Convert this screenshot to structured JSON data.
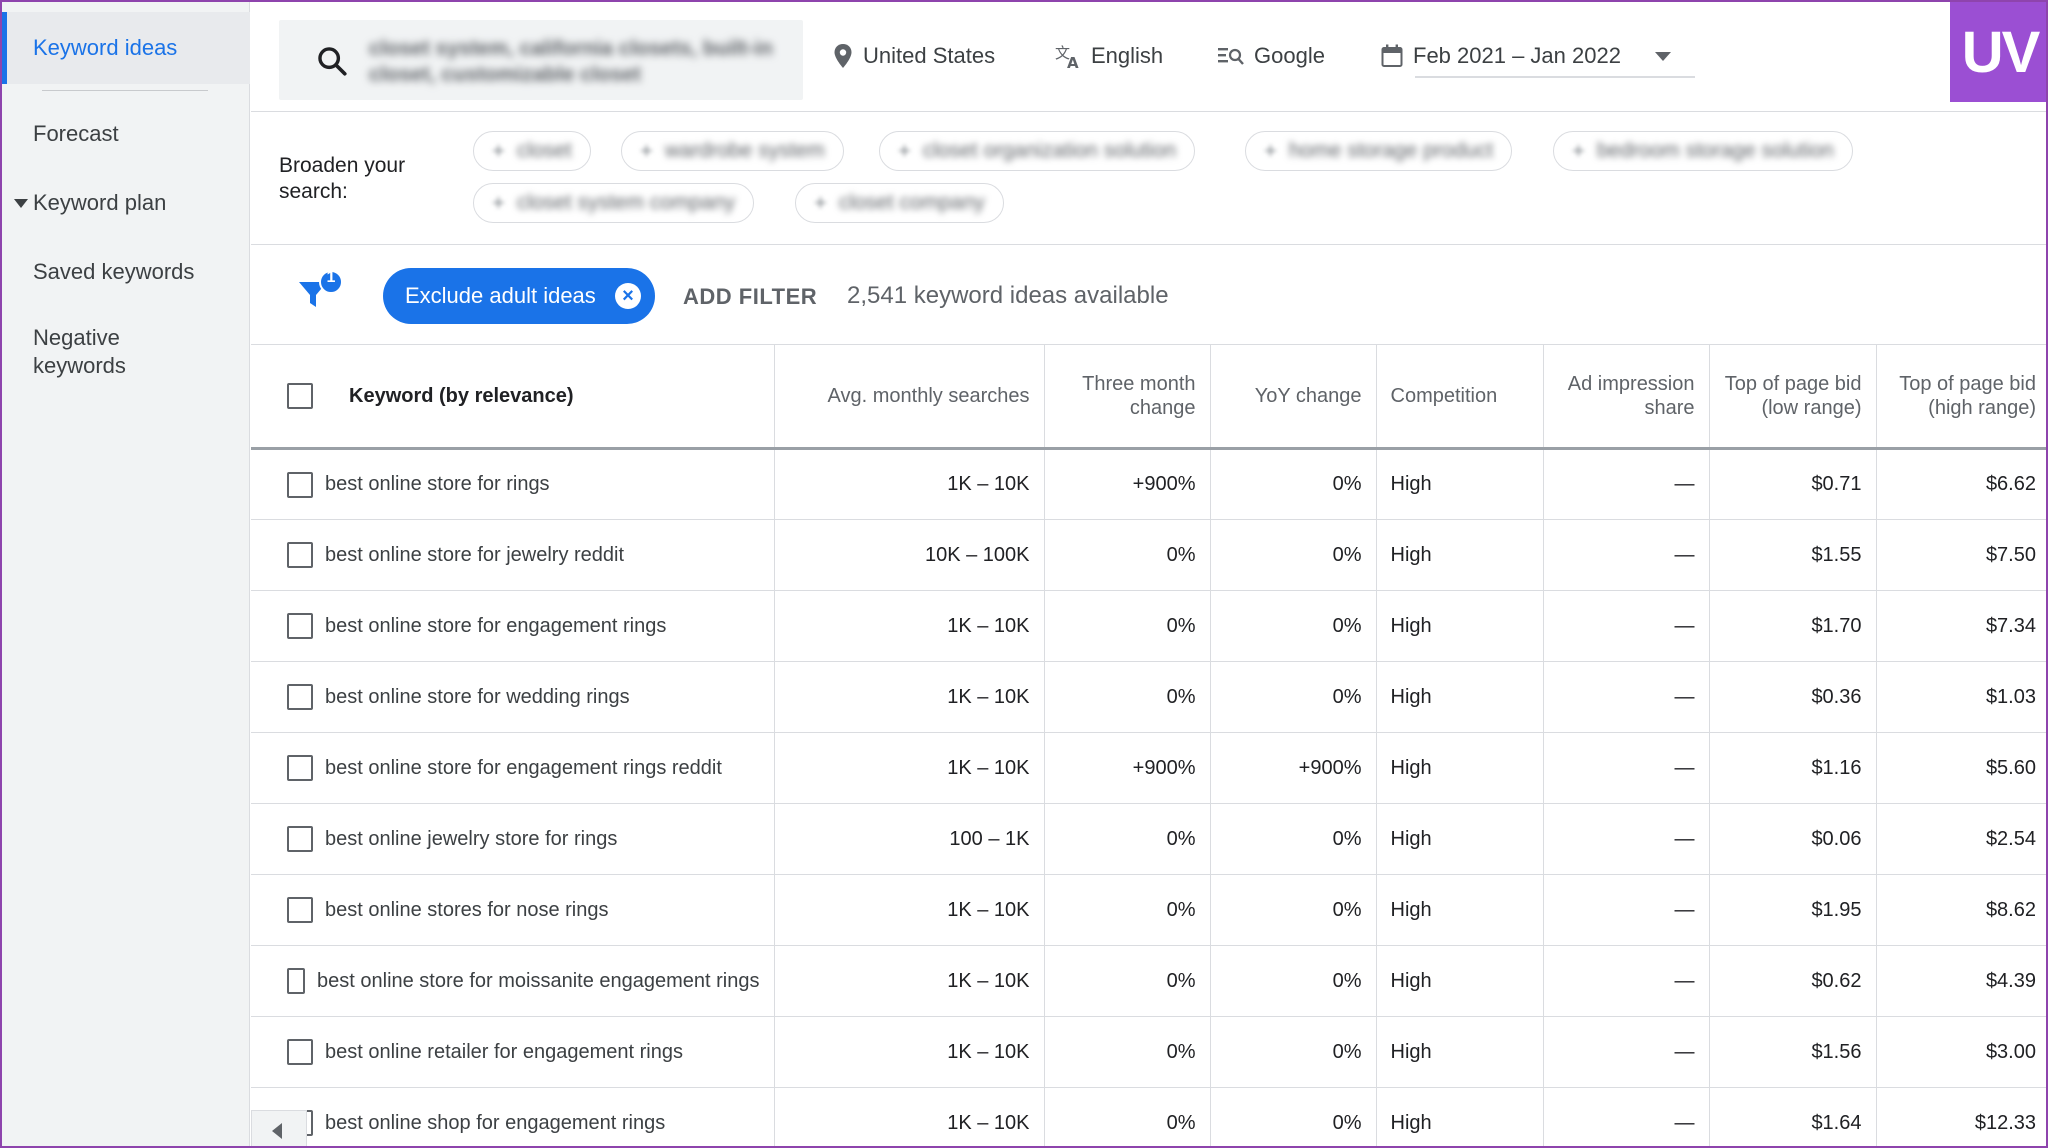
{
  "sidebar": {
    "items": [
      {
        "label": "Keyword ideas",
        "active": true
      },
      {
        "label": "Forecast"
      },
      {
        "label": "Keyword plan"
      },
      {
        "label": "Saved keywords"
      },
      {
        "label": "Negative keywords"
      }
    ]
  },
  "topbar": {
    "search_value": "closet system, california closets, built-in closet, customizable closet",
    "location": "United States",
    "language": "English",
    "network": "Google",
    "date_range": "Feb 2021 – Jan 2022",
    "brand_logo": "UV"
  },
  "broaden": {
    "label": "Broaden your search:",
    "chips": [
      "closet",
      "wardrobe system",
      "closet organization solution",
      "home storage product",
      "bedroom storage solution",
      "closet system company",
      "closet company"
    ]
  },
  "filters": {
    "badge_count": "1",
    "exclude_chip": "Exclude adult ideas",
    "add_filter": "ADD FILTER",
    "count_text": "2,541 keyword ideas available"
  },
  "table": {
    "headers": {
      "keyword": "Keyword (by relevance)",
      "avg": "Avg. monthly searches",
      "three_month": "Three month change",
      "yoy": "YoY change",
      "competition": "Competition",
      "ad_share": "Ad impression share",
      "bid_low": "Top of page bid (low range)",
      "bid_high": "Top of page bid (high range)"
    },
    "rows": [
      {
        "keyword": "best online store for rings",
        "avg": "1K – 10K",
        "three_month": "+900%",
        "yoy": "0%",
        "competition": "High",
        "ad_share": "—",
        "bid_low": "$0.71",
        "bid_high": "$6.62"
      },
      {
        "keyword": "best online store for jewelry reddit",
        "avg": "10K – 100K",
        "three_month": "0%",
        "yoy": "0%",
        "competition": "High",
        "ad_share": "—",
        "bid_low": "$1.55",
        "bid_high": "$7.50"
      },
      {
        "keyword": "best online store for engagement rings",
        "avg": "1K – 10K",
        "three_month": "0%",
        "yoy": "0%",
        "competition": "High",
        "ad_share": "—",
        "bid_low": "$1.70",
        "bid_high": "$7.34"
      },
      {
        "keyword": "best online store for wedding rings",
        "avg": "1K – 10K",
        "three_month": "0%",
        "yoy": "0%",
        "competition": "High",
        "ad_share": "—",
        "bid_low": "$0.36",
        "bid_high": "$1.03"
      },
      {
        "keyword": "best online store for engagement rings reddit",
        "avg": "1K – 10K",
        "three_month": "+900%",
        "yoy": "+900%",
        "competition": "High",
        "ad_share": "—",
        "bid_low": "$1.16",
        "bid_high": "$5.60"
      },
      {
        "keyword": "best online jewelry store for rings",
        "avg": "100 – 1K",
        "three_month": "0%",
        "yoy": "0%",
        "competition": "High",
        "ad_share": "—",
        "bid_low": "$0.06",
        "bid_high": "$2.54"
      },
      {
        "keyword": "best online stores for nose rings",
        "avg": "1K – 10K",
        "three_month": "0%",
        "yoy": "0%",
        "competition": "High",
        "ad_share": "—",
        "bid_low": "$1.95",
        "bid_high": "$8.62"
      },
      {
        "keyword": "best online store for moissanite engagement rings",
        "avg": "1K – 10K",
        "three_month": "0%",
        "yoy": "0%",
        "competition": "High",
        "ad_share": "—",
        "bid_low": "$0.62",
        "bid_high": "$4.39"
      },
      {
        "keyword": "best online retailer for engagement rings",
        "avg": "1K – 10K",
        "three_month": "0%",
        "yoy": "0%",
        "competition": "High",
        "ad_share": "—",
        "bid_low": "$1.56",
        "bid_high": "$3.00"
      },
      {
        "keyword": "best online shop for engagement rings",
        "avg": "1K – 10K",
        "three_month": "0%",
        "yoy": "0%",
        "competition": "High",
        "ad_share": "—",
        "bid_low": "$1.64",
        "bid_high": "$12.33"
      }
    ]
  },
  "colors": {
    "accent": "#1a73e8",
    "brand": "#9b4fd3",
    "frame": "#8e44ad"
  }
}
